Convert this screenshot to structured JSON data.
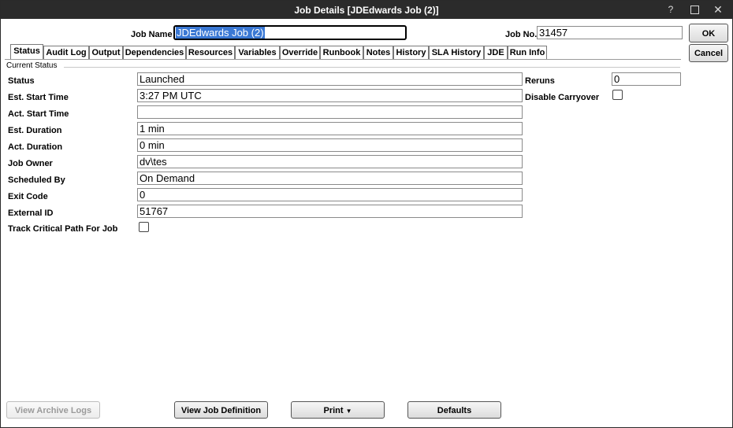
{
  "window": {
    "title": "Job Details [JDEdwards Job (2)]",
    "help_glyph": "?",
    "close_glyph": "✕"
  },
  "header": {
    "job_name_label": "Job Name",
    "job_name_value": "JDEdwards Job (2)",
    "job_no_label": "Job No.",
    "job_no_value": "31457"
  },
  "actions": {
    "ok_label": "OK",
    "cancel_label": "Cancel"
  },
  "tabs": [
    {
      "label": "Status",
      "active": true
    },
    {
      "label": "Audit Log"
    },
    {
      "label": "Output"
    },
    {
      "label": "Dependencies"
    },
    {
      "label": "Resources"
    },
    {
      "label": "Variables"
    },
    {
      "label": "Override"
    },
    {
      "label": "Runbook"
    },
    {
      "label": "Notes"
    },
    {
      "label": "History"
    },
    {
      "label": "SLA History"
    },
    {
      "label": "JDE"
    },
    {
      "label": "Run Info"
    }
  ],
  "status_panel": {
    "group_label": "Current Status",
    "fields": [
      {
        "label": "Status",
        "value": "Launched"
      },
      {
        "label": "Est. Start Time",
        "value": "3:27 PM UTC"
      },
      {
        "label": "Act. Start Time",
        "value": ""
      },
      {
        "label": "Est. Duration",
        "value": "1 min"
      },
      {
        "label": "Act. Duration",
        "value": "0 min"
      },
      {
        "label": "Job Owner",
        "value": "dv\\tes"
      },
      {
        "label": "Scheduled By",
        "value": "On Demand"
      },
      {
        "label": "Exit Code",
        "value": "0"
      },
      {
        "label": "External ID",
        "value": "51767"
      }
    ],
    "track_critical_path_label": "Track Critical Path For Job",
    "track_critical_path_checked": false,
    "reruns_label": "Reruns",
    "reruns_value": "0",
    "disable_carryover_label": "Disable Carryover",
    "disable_carryover_checked": false
  },
  "footer": {
    "view_archive_logs_label": "View Archive Logs",
    "view_job_definition_label": "View Job Definition",
    "print_label": "Print",
    "defaults_label": "Defaults"
  },
  "colors": {
    "titlebar": "#2b2b2b",
    "selection": "#3a78d4"
  }
}
